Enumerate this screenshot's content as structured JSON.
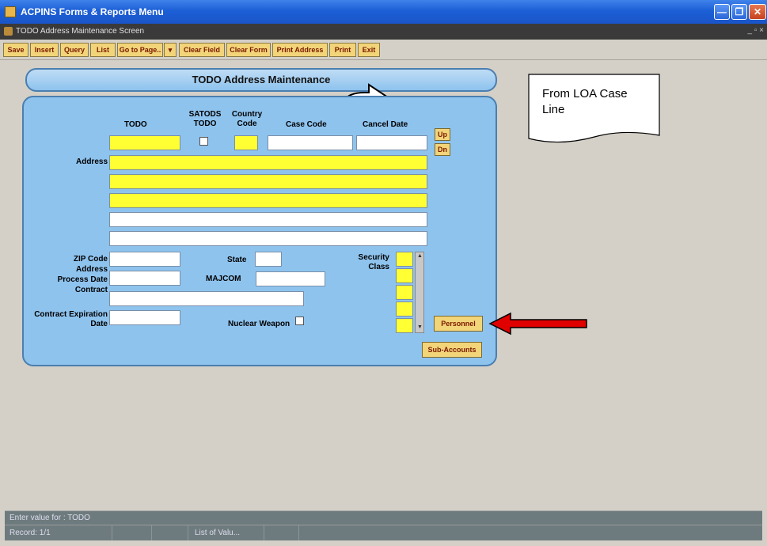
{
  "window": {
    "title": "ACPINS Forms & Reports Menu",
    "inner_title": "TODO Address Maintenance Screen",
    "inner_controls": "_ ▫ ×"
  },
  "toolbar": {
    "buttons": [
      "Save",
      "Insert",
      "Query",
      "List",
      "Go to Page..",
      "Clear Field",
      "Clear Form",
      "Print Address",
      "Print",
      "Exit"
    ]
  },
  "form": {
    "title": "TODO Address Maintenance",
    "labels": {
      "todo": "TODO",
      "satods_todo": "SATODS TODO",
      "country_code": "Country Code",
      "case_code": "Case Code",
      "cancel_date": "Cancel Date",
      "address": "Address",
      "zip_code": "ZIP Code",
      "address2": "Address",
      "process_date": "Process Date",
      "contract": "Contract",
      "contract_exp": "Contract Expiration Date",
      "state": "State",
      "majcom": "MAJCOM",
      "nuclear_weapon": "Nuclear Weapon",
      "security_class": "Security Class"
    },
    "buttons": {
      "up": "Up",
      "dn": "Dn",
      "personnel": "Personnel",
      "sub_accounts": "Sub-Accounts"
    }
  },
  "callout": {
    "text": "From LOA Case Line"
  },
  "status": {
    "message": "Enter value for : TODO",
    "record": "Record: 1/1",
    "lov": "List of Valu..."
  },
  "colors": {
    "required_field": "#ffff33",
    "panel": "#8ec3ee",
    "arrow": "#e00000"
  }
}
